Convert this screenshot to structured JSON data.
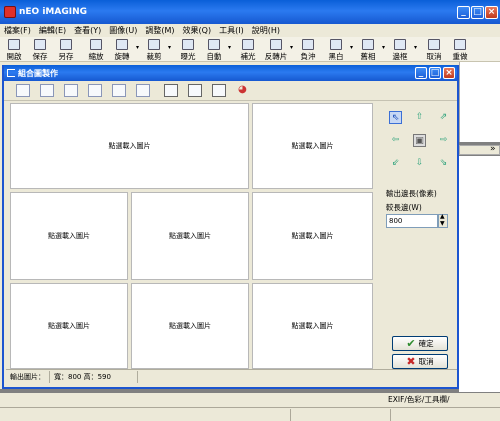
{
  "app": {
    "title": "nEO iMAGING"
  },
  "menu": [
    "檔案(F)",
    "編輯(E)",
    "查看(Y)",
    "圖像(U)",
    "調整(M)",
    "效果(Q)",
    "工具(I)",
    "說明(H)"
  ],
  "toolbar": [
    "開啟",
    "保存",
    "另存",
    "縮放",
    "旋轉",
    "裁剪",
    "曝光",
    "自動",
    "補光",
    "反轉片",
    "負沖",
    "黑白",
    "舊相",
    "邊框",
    "取消",
    "重做"
  ],
  "dialog": {
    "title": "組合圖製作",
    "cell_text": "點選載入圖片",
    "output_label": "輸出邊長(像素)",
    "width_label": "較長邊(W)",
    "width_value": "800",
    "ok_label": "確定",
    "cancel_label": "取消",
    "status_label": "輸出圖片：",
    "status_size": "寬：800 高：590"
  },
  "side_panel": {
    "arrow": "»"
  },
  "bottom_tabs": "EXIF/色彩/工具欄/",
  "colors": {
    "title_blue": "#1658d0",
    "ok_green": "#2e8b2e",
    "cancel_red": "#c62828"
  }
}
